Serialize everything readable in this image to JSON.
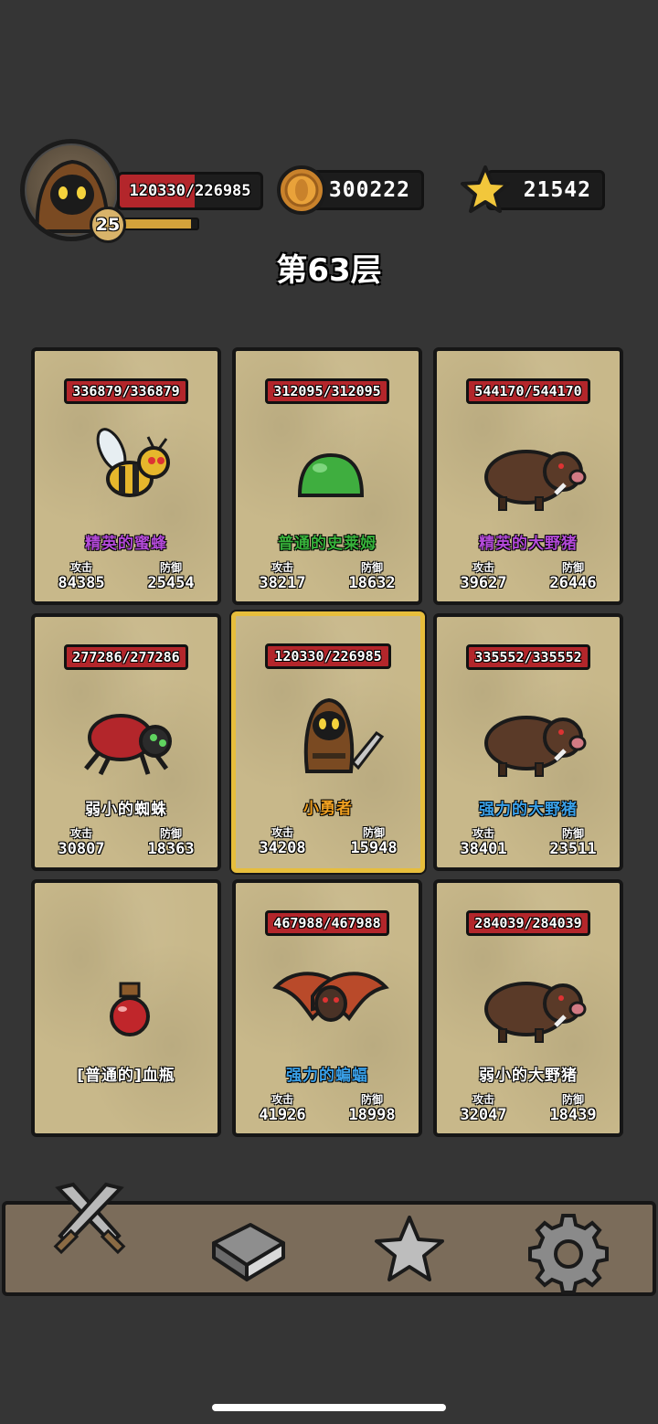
{
  "hud": {
    "player_hp": "120330/226985",
    "player_hp_fraction": 0.53,
    "level": "25",
    "xp_fraction": 0.92,
    "coins": "300222",
    "stars": "21542"
  },
  "floor_title": "第63层",
  "labels": {
    "attack": "攻击",
    "defense": "防御"
  },
  "cards": [
    {
      "hp": "336879/336879",
      "name": "精英的蜜蜂",
      "name_color": "#b34ad8",
      "attack": "84385",
      "defense": "25454",
      "icon": "bee-icon"
    },
    {
      "hp": "312095/312095",
      "name": "普通的史莱姆",
      "name_color": "#37b23b",
      "attack": "38217",
      "defense": "18632",
      "icon": "slime-icon"
    },
    {
      "hp": "544170/544170",
      "name": "精英的大野猪",
      "name_color": "#b34ad8",
      "attack": "39627",
      "defense": "26446",
      "icon": "boar-icon"
    },
    {
      "hp": "277286/277286",
      "name": "弱小的蜘蛛",
      "name_color": "#ffffff",
      "attack": "30807",
      "defense": "18363",
      "icon": "spider-icon"
    },
    {
      "hp": "120330/226985",
      "name": "小勇者",
      "name_color": "#f0a020",
      "attack": "34208",
      "defense": "15948",
      "icon": "hooded-hero-icon"
    },
    {
      "hp": "335552/335552",
      "name": "强力的大野猪",
      "name_color": "#3aa0e8",
      "attack": "38401",
      "defense": "23511",
      "icon": "boar-icon"
    },
    {
      "name": "[普通的]血瓶",
      "name_color": "#ffffff",
      "icon": "health-potion-icon"
    },
    {
      "hp": "467988/467988",
      "name": "强力的蝙蝠",
      "name_color": "#3aa0e8",
      "attack": "41926",
      "defense": "18998",
      "icon": "bat-icon"
    },
    {
      "hp": "284039/284039",
      "name": "弱小的大野猪",
      "name_color": "#ffffff",
      "attack": "32047",
      "defense": "18439",
      "icon": "boar-icon"
    }
  ],
  "nav": [
    "crossed-swords-icon",
    "book-icon",
    "star-icon",
    "gear-icon"
  ],
  "colors": {
    "background": "#353535",
    "card": "#c8b88a",
    "selected_border": "#e7be3c",
    "hp_red": "#b3262b",
    "bar": "#7b6c5a"
  }
}
